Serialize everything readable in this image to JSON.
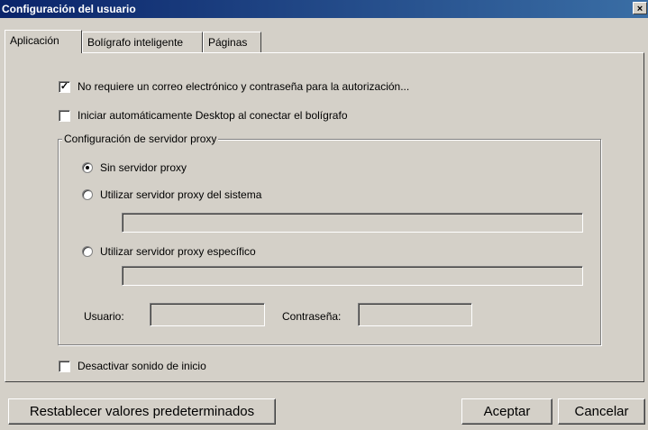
{
  "window": {
    "title": "Configuración del usuario",
    "close_glyph": "×"
  },
  "tabs": [
    "Aplicación",
    "Bolígrafo inteligente",
    "Páginas"
  ],
  "options": {
    "no_email": {
      "label": "No requiere un correo electrónico y contraseña para la autorización...",
      "checked": true
    },
    "autostart": {
      "label": "Iniciar automáticamente Desktop al conectar el bolígrafo",
      "checked": false
    },
    "disable_sound": {
      "label": "Desactivar sonido de inicio",
      "checked": false
    }
  },
  "proxy": {
    "group_label": "Configuración de servidor proxy",
    "none": "Sin servidor proxy",
    "system": "Utilizar servidor proxy del sistema",
    "specific": "Utilizar servidor proxy específico",
    "selected": "none",
    "user_label": "Usuario:",
    "password_label": "Contraseña:"
  },
  "buttons": {
    "reset": "Restablecer valores predeterminados",
    "ok": "Aceptar",
    "cancel": "Cancelar"
  },
  "check_glyph": "✓"
}
